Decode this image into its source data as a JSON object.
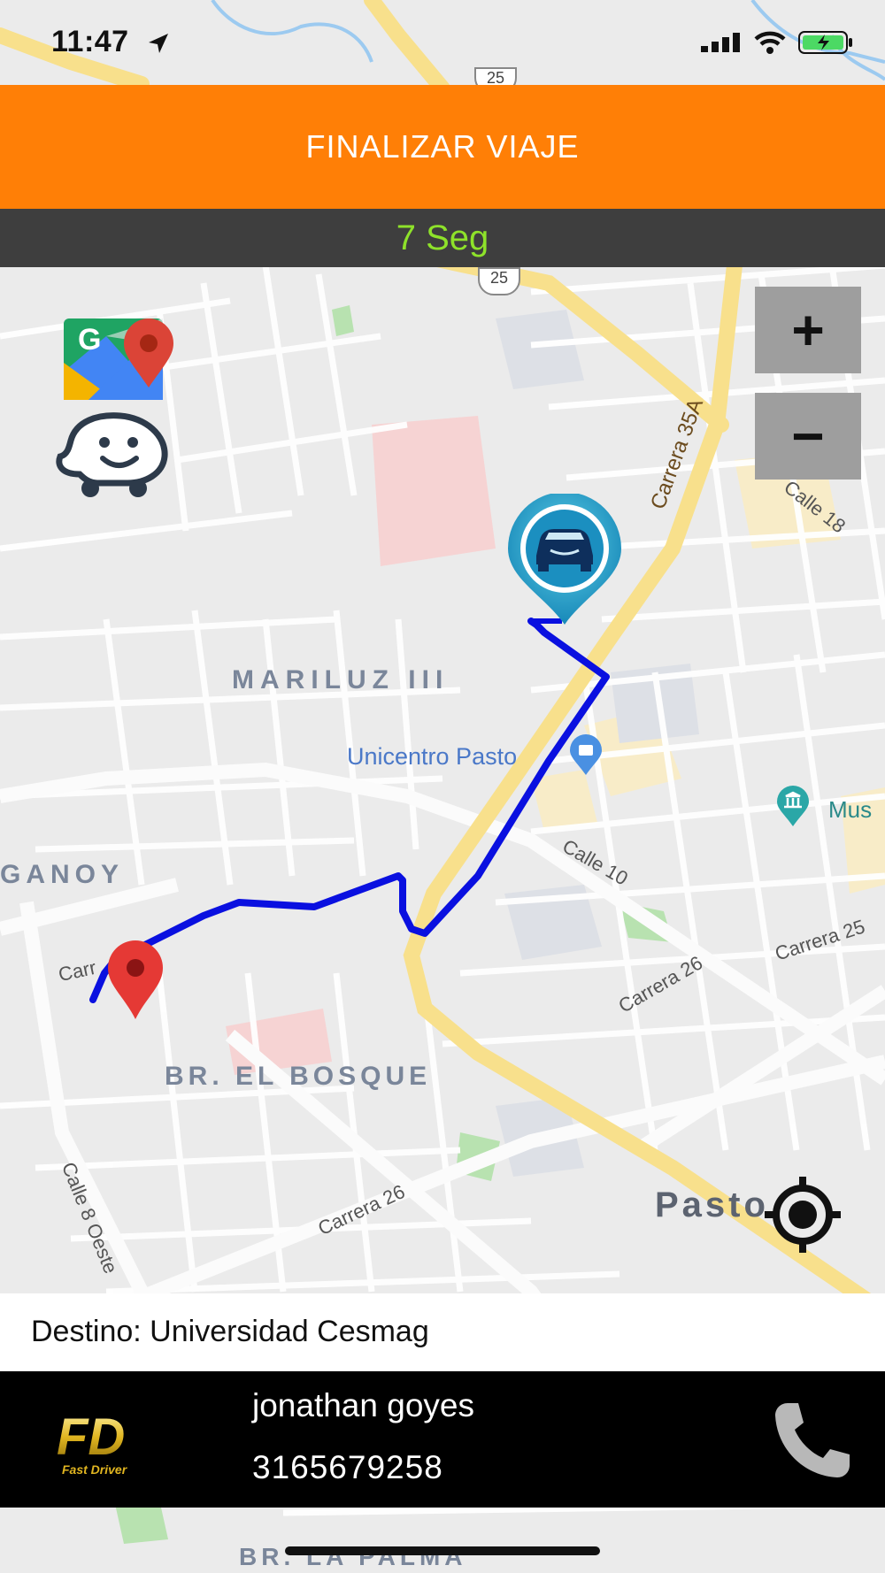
{
  "status_bar": {
    "time": "11:47"
  },
  "header": {
    "finish_label": "FINALIZAR VIAJE",
    "timer": "7 Seg"
  },
  "map": {
    "zoom_in": "+",
    "zoom_out": "−",
    "labels": {
      "mariluz": "MARILUZ III",
      "unicentro": "Unicentro Pasto",
      "ganoy": "GANOY",
      "el_bosque": "BR. EL BOSQUE",
      "pasto": "Pasto",
      "museo": "Mus",
      "carrera_35a": "Carrera 35A",
      "calle_18": "Calle 18",
      "calle_10": "Calle 10",
      "carrera_25": "Carrera 25",
      "carrera_26_top": "Carrera 26",
      "carrera_26_bottom": "Carrera 26",
      "calle_8_oeste": "Calle 8 Oeste",
      "carrera_left": "Carr",
      "la_palma": "BR. LA PALMA",
      "road_25_top": "25",
      "road_25": "25"
    },
    "icons": [
      "google-maps-icon",
      "waze-icon",
      "car-pin-icon",
      "destination-pin-icon",
      "my-location-icon"
    ]
  },
  "destination": {
    "text": "Destino: Universidad Cesmag"
  },
  "driver": {
    "name": "jonathan goyes",
    "phone": "3165679258",
    "logo_text": "FD",
    "logo_subtext": "Fast Driver"
  },
  "colors": {
    "accent": "#ff7f06",
    "timer": "#8ee22a",
    "route": "#0a10e0"
  }
}
